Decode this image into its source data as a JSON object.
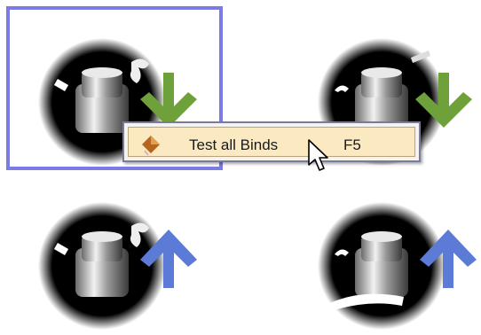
{
  "colors": {
    "selection": "#7b7be3",
    "arrow_down": "#6fa13a",
    "arrow_up": "#5b7bd6",
    "menu_highlight": "#fbe9c2"
  },
  "context_menu": {
    "item_icon": "gem-icon",
    "item_label": "Test all Binds",
    "item_shortcut": "F5"
  },
  "tiles": [
    {
      "name": "pedal-1",
      "arrow": "down",
      "selected": true
    },
    {
      "name": "pedal-2",
      "arrow": "down",
      "selected": false
    },
    {
      "name": "pedal-3",
      "arrow": "up",
      "selected": false
    },
    {
      "name": "pedal-4",
      "arrow": "up",
      "selected": false
    }
  ]
}
